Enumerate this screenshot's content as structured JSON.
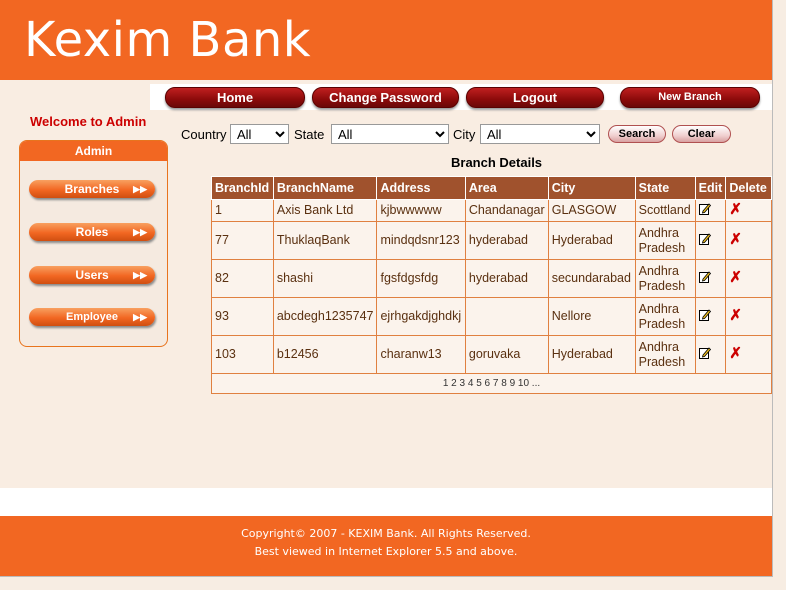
{
  "header": {
    "title": "Kexim Bank"
  },
  "nav": {
    "home": "Home",
    "change_password": "Change Password",
    "logout": "Logout",
    "new_branch": "New Branch"
  },
  "sidebar": {
    "welcome": "Welcome to Admin",
    "heading": "Admin",
    "items": [
      {
        "label": "Branches"
      },
      {
        "label": "Roles"
      },
      {
        "label": "Users"
      },
      {
        "label": "Employee"
      }
    ]
  },
  "filters": {
    "country_label": "Country",
    "country_value": "All",
    "state_label": "State",
    "state_value": "All",
    "city_label": "City",
    "city_value": "All",
    "search": "Search",
    "clear": "Clear"
  },
  "table": {
    "title": "Branch Details",
    "headers": [
      "BranchId",
      "BranchName",
      "Address",
      "Area",
      "City",
      "State",
      "Edit",
      "Delete"
    ],
    "rows": [
      [
        "1",
        "Axis Bank Ltd",
        "kjbwwwww",
        "Chandanagar",
        "GLASGOW",
        "Scottland"
      ],
      [
        "77",
        "ThuklaqBank",
        "mindqdsnr123",
        "hyderabad",
        "Hyderabad",
        "Andhra Pradesh"
      ],
      [
        "82",
        "shashi",
        "fgsfdgsfdg",
        "hyderabad",
        "secundarabad",
        "Andhra Pradesh"
      ],
      [
        "93",
        "abcdegh1235747",
        "ejrhgakdjghdkj",
        "",
        "Nellore",
        "Andhra Pradesh"
      ],
      [
        "103",
        "b12456",
        "charanw13",
        "goruvaka",
        "Hyderabad",
        "Andhra Pradesh"
      ]
    ],
    "pager": "1 2 3 4 5 6 7 8 9 10 ..."
  },
  "footer": {
    "copyright": "Copyright© 2007 - KEXIM Bank. All Rights Reserved.",
    "note": "Best viewed in Internet Explorer 5.5 and above."
  },
  "colors": {
    "brand": "#f26722",
    "table_header": "#a0522d",
    "welcome": "#cc0000"
  },
  "icons": {
    "edit": "edit-icon",
    "delete": "delete-icon",
    "arrow": "double-arrow-icon"
  }
}
